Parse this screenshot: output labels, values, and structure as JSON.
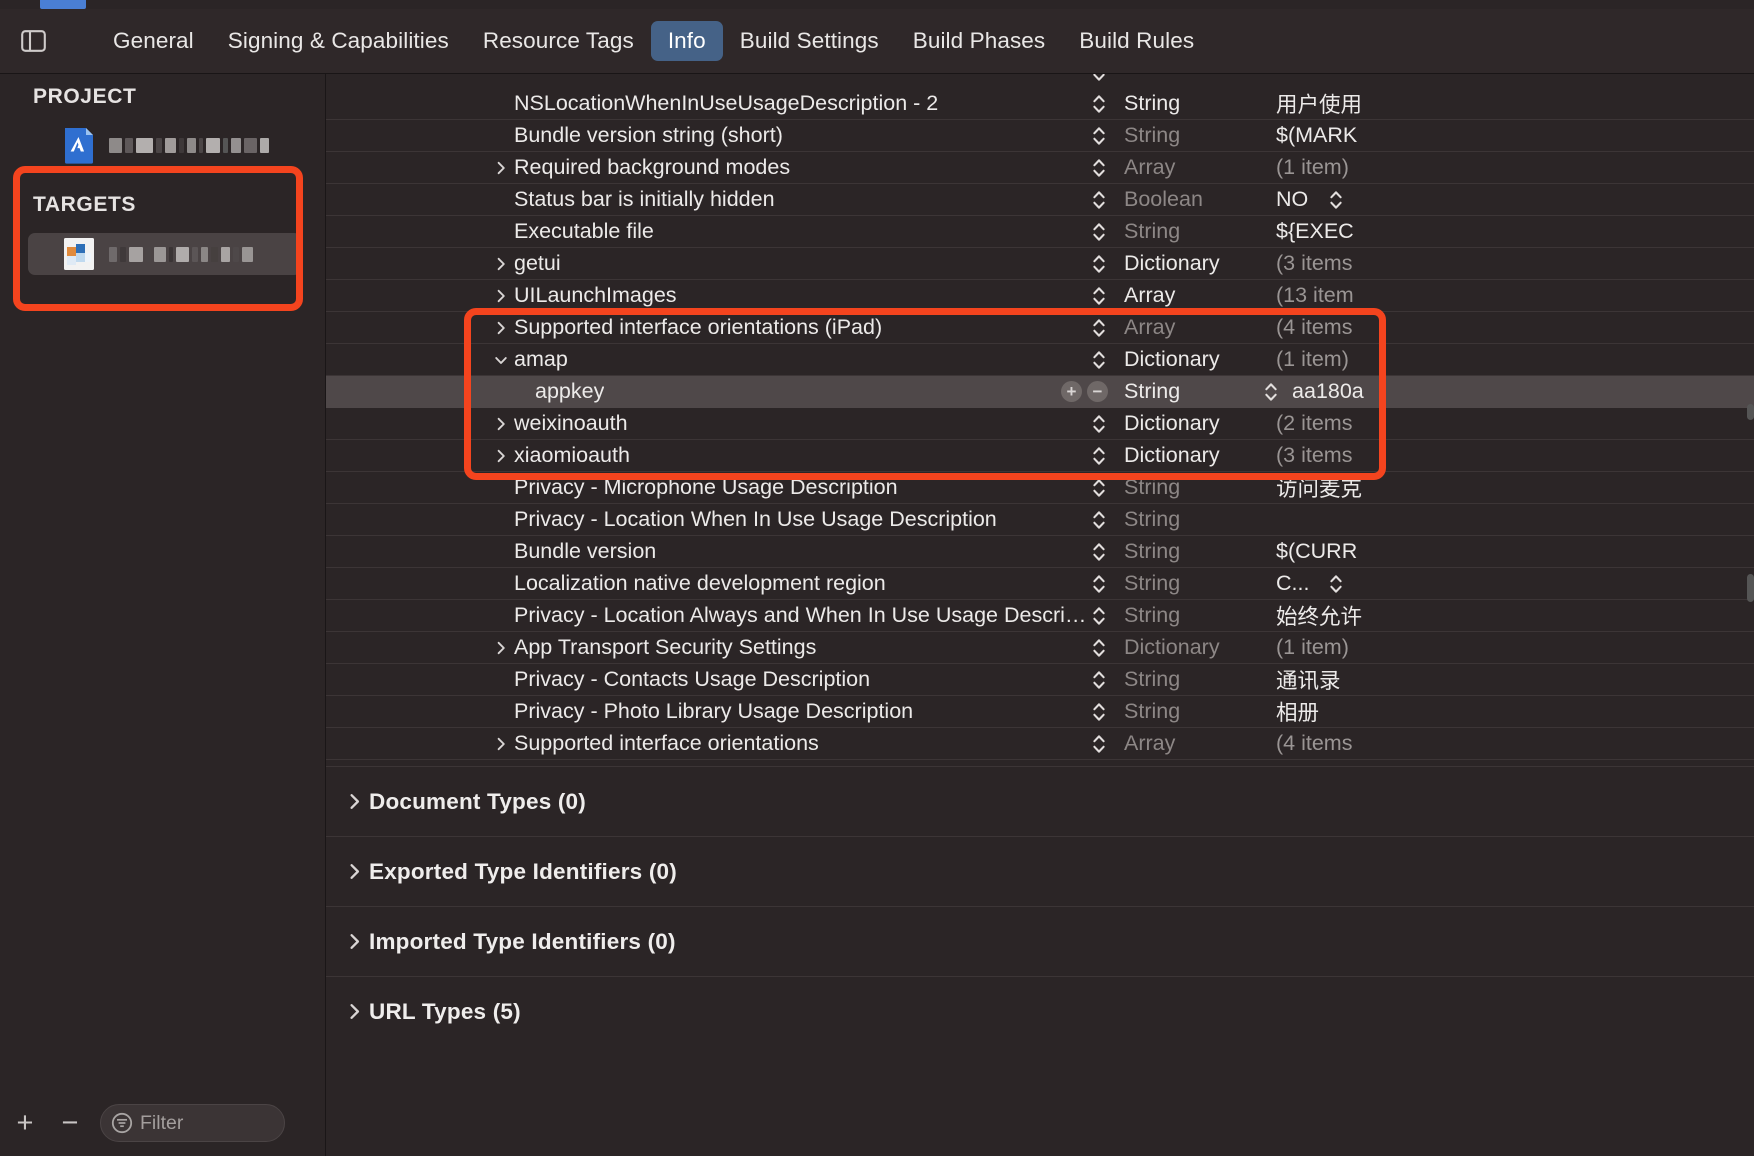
{
  "window": {
    "accent_blue": "#4a7fd4",
    "annotation_color": "#f4441e",
    "background": "#2b2526"
  },
  "tabbar": {
    "sidebar_toggle_icon": "sidebar-toggle-icon",
    "tabs": [
      {
        "label": "General",
        "active": false
      },
      {
        "label": "Signing & Capabilities",
        "active": false
      },
      {
        "label": "Resource Tags",
        "active": false
      },
      {
        "label": "Info",
        "active": true
      },
      {
        "label": "Build Settings",
        "active": false
      },
      {
        "label": "Build Phases",
        "active": false
      },
      {
        "label": "Build Rules",
        "active": false
      }
    ]
  },
  "sidebar": {
    "project_header": "PROJECT",
    "targets_header": "TARGETS",
    "project_item": {
      "name_redacted": true,
      "icon": "xcode-project-icon"
    },
    "target_item": {
      "name_redacted": true,
      "icon": "app-target-icon",
      "selected": true
    },
    "bottom_toolbar": {
      "add_label": "+",
      "remove_label": "−",
      "filter_placeholder": "Filter",
      "filter_value": "",
      "filter_icon": "filter-icon"
    }
  },
  "plist": {
    "rows": [
      {
        "key": "",
        "type": "",
        "value": "",
        "partial_top": true,
        "expandable": false,
        "dim_type": true
      },
      {
        "key": "NSLocationWhenInUseUsageDescription - 2",
        "type": "String",
        "value": "用户使用",
        "expandable": false,
        "dim_type": false,
        "dim_value": false
      },
      {
        "key": "Bundle version string (short)",
        "type": "String",
        "value": "$(MARK",
        "expandable": false,
        "dim_type": true,
        "dim_value": false
      },
      {
        "key": "Required background modes",
        "type": "Array",
        "value": "(1 item)",
        "expandable": true,
        "expanded": false,
        "dim_type": true,
        "dim_value": true
      },
      {
        "key": "Status bar is initially hidden",
        "type": "Boolean",
        "value": "NO",
        "has_value_stepper": true,
        "expandable": false,
        "dim_type": true,
        "dim_value": false
      },
      {
        "key": "Executable file",
        "type": "String",
        "value": "${EXEC",
        "expandable": false,
        "dim_type": true,
        "dim_value": false
      },
      {
        "key": "getui",
        "type": "Dictionary",
        "value": "(3 items",
        "expandable": true,
        "expanded": false,
        "dim_type": false,
        "dim_value": true
      },
      {
        "key": "UILaunchImages",
        "type": "Array",
        "value": "(13 item",
        "expandable": true,
        "expanded": false,
        "dim_type": false,
        "dim_value": true
      },
      {
        "key": "Supported interface orientations (iPad)",
        "type": "Array",
        "value": "(4 items",
        "expandable": true,
        "expanded": false,
        "dim_type": true,
        "dim_value": true
      },
      {
        "key": "amap",
        "type": "Dictionary",
        "value": "(1 item)",
        "expandable": true,
        "expanded": true,
        "dim_type": false,
        "dim_value": true
      },
      {
        "key": "appkey",
        "type": "String",
        "value": "aa180a",
        "child": true,
        "selected": true,
        "show_plus_minus": true,
        "has_value_stepper": true,
        "dim_type": false,
        "dim_value": false
      },
      {
        "key": "weixinoauth",
        "type": "Dictionary",
        "value": "(2 items",
        "expandable": true,
        "expanded": false,
        "dim_type": false,
        "dim_value": true
      },
      {
        "key": "xiaomioauth",
        "type": "Dictionary",
        "value": "(3 items",
        "expandable": true,
        "expanded": false,
        "dim_type": false,
        "dim_value": true
      },
      {
        "key": "Privacy - Microphone Usage Description",
        "type": "String",
        "value": "访问麦克",
        "expandable": false,
        "dim_type": true,
        "dim_value": false
      },
      {
        "key": "Privacy - Location When In Use Usage Description",
        "type": "String",
        "value": "",
        "expandable": false,
        "dim_type": true,
        "dim_value": false
      },
      {
        "key": "Bundle version",
        "type": "String",
        "value": "$(CURR",
        "expandable": false,
        "dim_type": true,
        "dim_value": false
      },
      {
        "key": "Localization native development region",
        "type": "String",
        "value": "C...",
        "has_value_stepper": true,
        "expandable": false,
        "dim_type": true,
        "dim_value": false
      },
      {
        "key": "Privacy - Location Always and When In Use Usage Descri…",
        "type": "String",
        "value": "始终允许",
        "expandable": false,
        "dim_type": true,
        "dim_value": false
      },
      {
        "key": "App Transport Security Settings",
        "type": "Dictionary",
        "value": "(1 item)",
        "expandable": true,
        "expanded": false,
        "dim_type": true,
        "dim_value": true
      },
      {
        "key": "Privacy - Contacts Usage Description",
        "type": "String",
        "value": "通讯录",
        "expandable": false,
        "dim_type": true,
        "dim_value": false
      },
      {
        "key": "Privacy - Photo Library Usage Description",
        "type": "String",
        "value": "相册",
        "expandable": false,
        "dim_type": true,
        "dim_value": false
      },
      {
        "key": "Supported interface orientations",
        "type": "Array",
        "value": "(4 items",
        "expandable": true,
        "expanded": false,
        "dim_type": true,
        "dim_value": true
      }
    ]
  },
  "sections": [
    {
      "label": "Document Types (0)",
      "expanded": false
    },
    {
      "label": "Exported Type Identifiers (0)",
      "expanded": false
    },
    {
      "label": "Imported Type Identifiers (0)",
      "expanded": false
    },
    {
      "label": "URL Types (5)",
      "expanded": false
    }
  ],
  "annotations": [
    {
      "name": "targets-highlight-box"
    },
    {
      "name": "amap-dictionary-highlight-box"
    }
  ]
}
